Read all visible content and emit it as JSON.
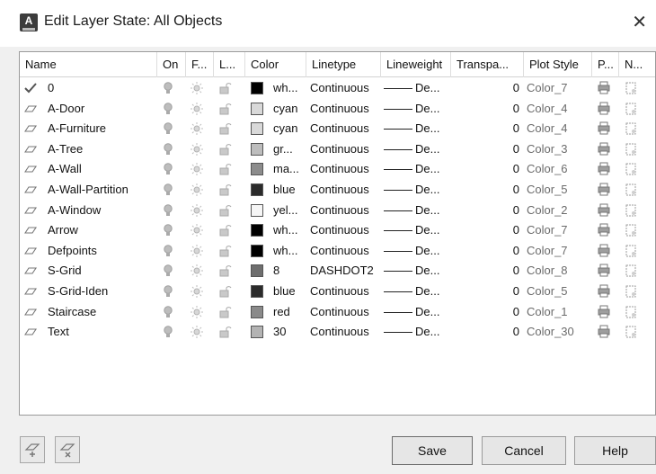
{
  "window": {
    "title": "Edit Layer State: All Objects",
    "close_glyph": "✕"
  },
  "columns": [
    "Name",
    "On",
    "F...",
    "L...",
    "Color",
    "Linetype",
    "Lineweight",
    "Transpa...",
    "Plot Style",
    "P...",
    "N..."
  ],
  "rows": [
    {
      "status": "current",
      "name": "0",
      "color_swatch": "#000000",
      "color": "wh...",
      "linetype": "Continuous",
      "lineweight": "De...",
      "transparency": "0",
      "plot_style": "Color_7"
    },
    {
      "status": "layer",
      "name": "A-Door",
      "color_swatch": "#d9d9d9",
      "color": "cyan",
      "linetype": "Continuous",
      "lineweight": "De...",
      "transparency": "0",
      "plot_style": "Color_4"
    },
    {
      "status": "layer",
      "name": "A-Furniture",
      "color_swatch": "#d9d9d9",
      "color": "cyan",
      "linetype": "Continuous",
      "lineweight": "De...",
      "transparency": "0",
      "plot_style": "Color_4"
    },
    {
      "status": "layer",
      "name": "A-Tree",
      "color_swatch": "#bdbdbd",
      "color": "gr...",
      "linetype": "Continuous",
      "lineweight": "De...",
      "transparency": "0",
      "plot_style": "Color_3"
    },
    {
      "status": "layer",
      "name": "A-Wall",
      "color_swatch": "#8c8c8c",
      "color": "ma...",
      "linetype": "Continuous",
      "lineweight": "De...",
      "transparency": "0",
      "plot_style": "Color_6"
    },
    {
      "status": "layer",
      "name": "A-Wall-Partition",
      "color_swatch": "#2b2b2b",
      "color": "blue",
      "linetype": "Continuous",
      "lineweight": "De...",
      "transparency": "0",
      "plot_style": "Color_5"
    },
    {
      "status": "layer",
      "name": "A-Window",
      "color_swatch": "#f6f6f6",
      "color": "yel...",
      "linetype": "Continuous",
      "lineweight": "De...",
      "transparency": "0",
      "plot_style": "Color_2"
    },
    {
      "status": "layer",
      "name": "Arrow",
      "color_swatch": "#000000",
      "color": "wh...",
      "linetype": "Continuous",
      "lineweight": "De...",
      "transparency": "0",
      "plot_style": "Color_7"
    },
    {
      "status": "layer",
      "name": "Defpoints",
      "color_swatch": "#000000",
      "color": "wh...",
      "linetype": "Continuous",
      "lineweight": "De...",
      "transparency": "0",
      "plot_style": "Color_7"
    },
    {
      "status": "layer",
      "name": "S-Grid",
      "color_swatch": "#6e6e6e",
      "color": "8",
      "linetype": "DASHDOT2",
      "lineweight": "De...",
      "transparency": "0",
      "plot_style": "Color_8"
    },
    {
      "status": "layer",
      "name": "S-Grid-Iden",
      "color_swatch": "#2b2b2b",
      "color": "blue",
      "linetype": "Continuous",
      "lineweight": "De...",
      "transparency": "0",
      "plot_style": "Color_5"
    },
    {
      "status": "layer",
      "name": "Staircase",
      "color_swatch": "#8a8a8a",
      "color": "red",
      "linetype": "Continuous",
      "lineweight": "De...",
      "transparency": "0",
      "plot_style": "Color_1"
    },
    {
      "status": "layer",
      "name": "Text",
      "color_swatch": "#b3b3b3",
      "color": "30",
      "linetype": "Continuous",
      "lineweight": "De...",
      "transparency": "0",
      "plot_style": "Color_30"
    }
  ],
  "buttons": {
    "save": "Save",
    "cancel": "Cancel",
    "help": "Help"
  }
}
